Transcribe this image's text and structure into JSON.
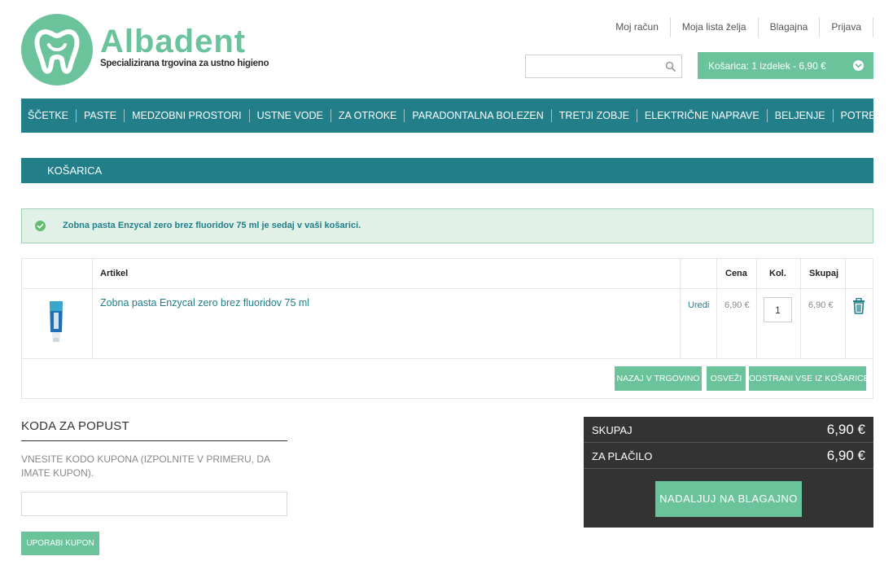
{
  "brand": {
    "name": "Albadent",
    "tagline": "Specializirana trgovina za ustno higieno",
    "color": "#6bc39c"
  },
  "top_links": [
    "Moj račun",
    "Moja lista želja",
    "Blagajna",
    "Prijava"
  ],
  "search": {
    "placeholder": "",
    "icon": "search-icon"
  },
  "cart": {
    "label": "Košarica: 1 izdelek - 6,90 €",
    "icon": "chevron-down-icon"
  },
  "nav": [
    "ŠČETKE",
    "PASTE",
    "MEDZOBNI PROSTORI",
    "USTNE VODE",
    "ZA OTROKE",
    "PARADONTALNA BOLEZEN",
    "TRETJI ZOBJE",
    "ELEKTRIČNE NAPRAVE",
    "BELJENJE",
    "POTREBUJEM TUDI"
  ],
  "nav_color": "#227f8a",
  "page_title": "KOŠARICA",
  "message": {
    "text": "Zobna pasta Enzycal zero brez fluoridov 75 ml je sedaj v vaši košarici.",
    "icon": "check-circle-icon"
  },
  "table": {
    "headers": {
      "article": "Artikel",
      "price": "Cena",
      "qty": "Kol.",
      "total": "Skupaj"
    },
    "items": [
      {
        "name": "Zobna pasta Enzycal zero brez fluoridov 75 ml",
        "edit": "Uredi",
        "price": "6,90 €",
        "qty": "1",
        "total": "6,90 €"
      }
    ],
    "buttons": {
      "back": "NAZAJ V TRGOVINO",
      "refresh": "OSVEŽI",
      "clear": "ODSTRANI VSE IZ KOŠARICE"
    }
  },
  "discount": {
    "title": "KODA ZA POPUST",
    "help": "VNESITE KODO KUPONA (IZPOLNITE V PRIMERU, DA IMATE KUPON).",
    "input_value": "",
    "button": "UPORABI KUPON"
  },
  "totals": {
    "subtotal_label": "SKUPAJ",
    "subtotal_value": "6,90 €",
    "pay_label": "ZA PLAČILO",
    "pay_value": "6,90 €",
    "checkout": "NADALJUJ NA BLAGAJNO"
  }
}
